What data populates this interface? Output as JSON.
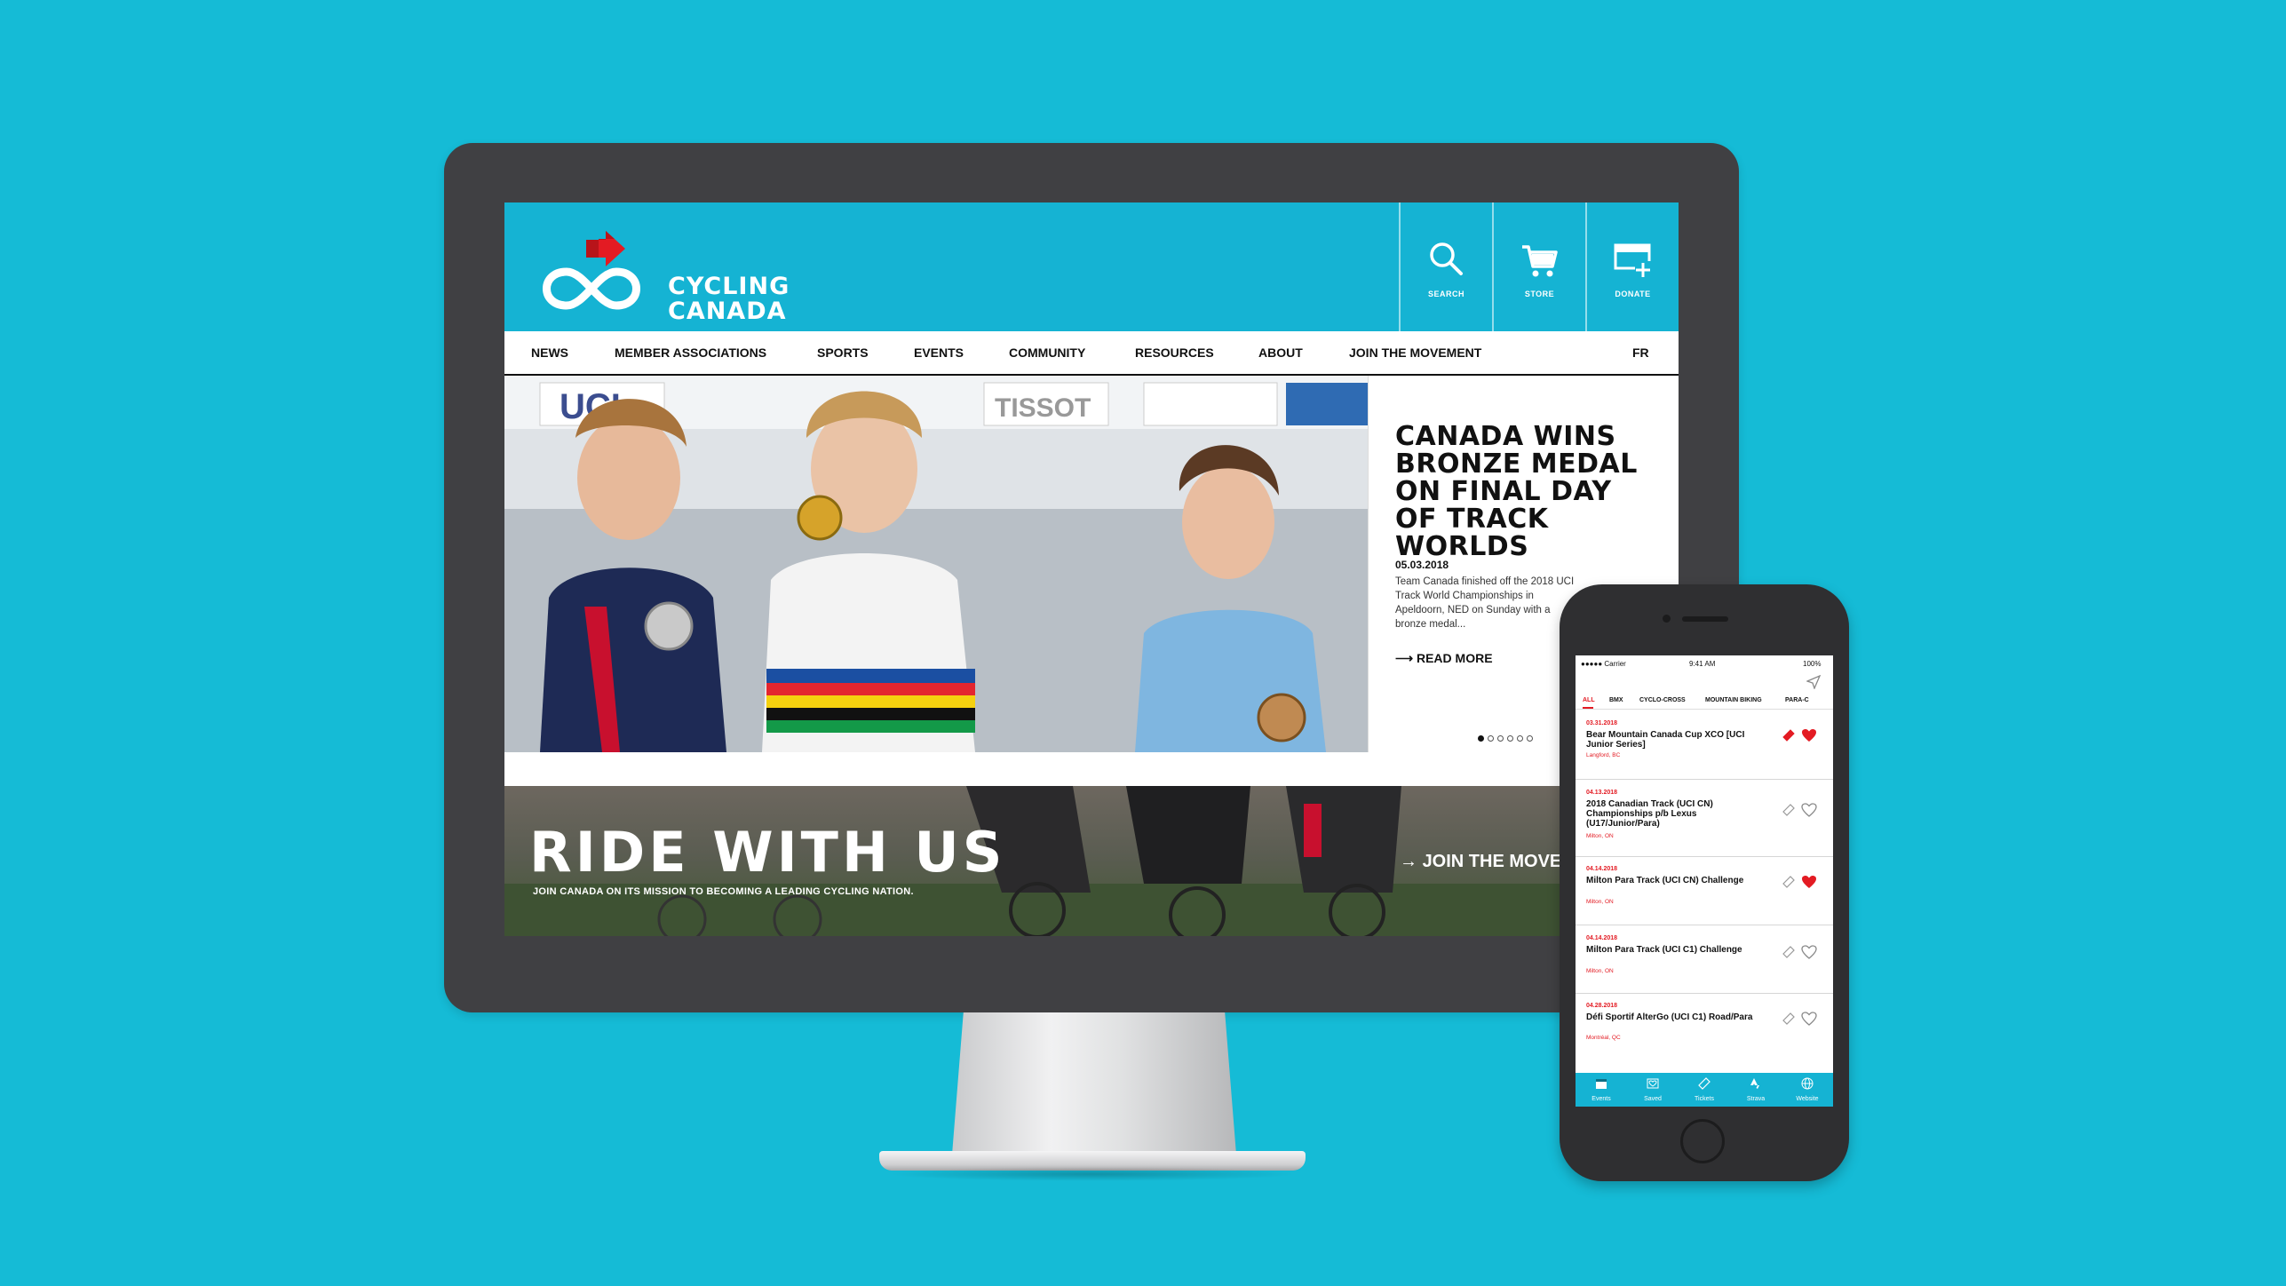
{
  "site": {
    "logo_line1": "CYCLING",
    "logo_line2": "CANADA",
    "header_buttons": [
      {
        "label": "SEARCH",
        "icon": "search-icon"
      },
      {
        "label": "STORE",
        "icon": "cart-icon"
      },
      {
        "label": "DONATE",
        "icon": "donate-icon"
      }
    ],
    "nav": [
      "NEWS",
      "MEMBER ASSOCIATIONS",
      "SPORTS",
      "EVENTS",
      "COMMUNITY",
      "RESOURCES",
      "ABOUT",
      "JOIN THE MOVEMENT"
    ],
    "lang": "FR",
    "feature": {
      "title": "CANADA WINS BRONZE MEDAL ON FINAL DAY OF TRACK WORLDS",
      "date": "05.03.2018",
      "body": "Team Canada finished off the 2018 UCI Track World Championships in Apeldoorn, NED on Sunday with a bronze medal...",
      "cta": "READ MORE"
    },
    "hero_sponsors": [
      "UCI",
      "TISSOT"
    ],
    "ride": {
      "title": "RIDE WITH US",
      "subtitle": "JOIN CANADA ON ITS MISSION TO BECOMING A LEADING CYCLING NATION.",
      "cta": "JOIN THE MOVEMENT"
    }
  },
  "app": {
    "status": {
      "carrier": "●●●●● Carrier",
      "time": "9:41 AM",
      "battery": "100%"
    },
    "tabs": [
      "ALL",
      "BMX",
      "CYCLO-CROSS",
      "MOUNTAIN BIKING",
      "PARA-C"
    ],
    "events": [
      {
        "date": "03.31.2018",
        "name": "Bear Mountain Canada Cup XCO [UCI Junior Series]",
        "location": "Langford, BC",
        "saved": true,
        "ticket": true
      },
      {
        "date": "04.13.2018",
        "name": "2018 Canadian Track (UCI CN) Championships p/b Lexus (U17/Junior/Para)",
        "location": "Milton, ON",
        "saved": false,
        "ticket": false
      },
      {
        "date": "04.14.2018",
        "name": "Milton Para Track (UCI CN) Challenge",
        "location": "Milton, ON",
        "saved": true,
        "ticket": false
      },
      {
        "date": "04.14.2018",
        "name": "Milton Para Track (UCI C1) Challenge",
        "location": "Milton, ON",
        "saved": false,
        "ticket": false
      },
      {
        "date": "04.28.2018",
        "name": "Défi Sportif AlterGo (UCI C1) Road/Para",
        "location": "Montréal, QC",
        "saved": false,
        "ticket": false
      }
    ],
    "tabbar": [
      {
        "label": "Events",
        "icon": "calendar-icon"
      },
      {
        "label": "Saved",
        "icon": "heart-icon"
      },
      {
        "label": "Tickets",
        "icon": "ticket-icon"
      },
      {
        "label": "Strava",
        "icon": "strava-icon"
      },
      {
        "label": "Website",
        "icon": "globe-icon"
      }
    ]
  },
  "colors": {
    "background": "#15bbd6",
    "brand": "#15b3d3",
    "accent_red": "#e31b23",
    "bezel": "#404043"
  }
}
